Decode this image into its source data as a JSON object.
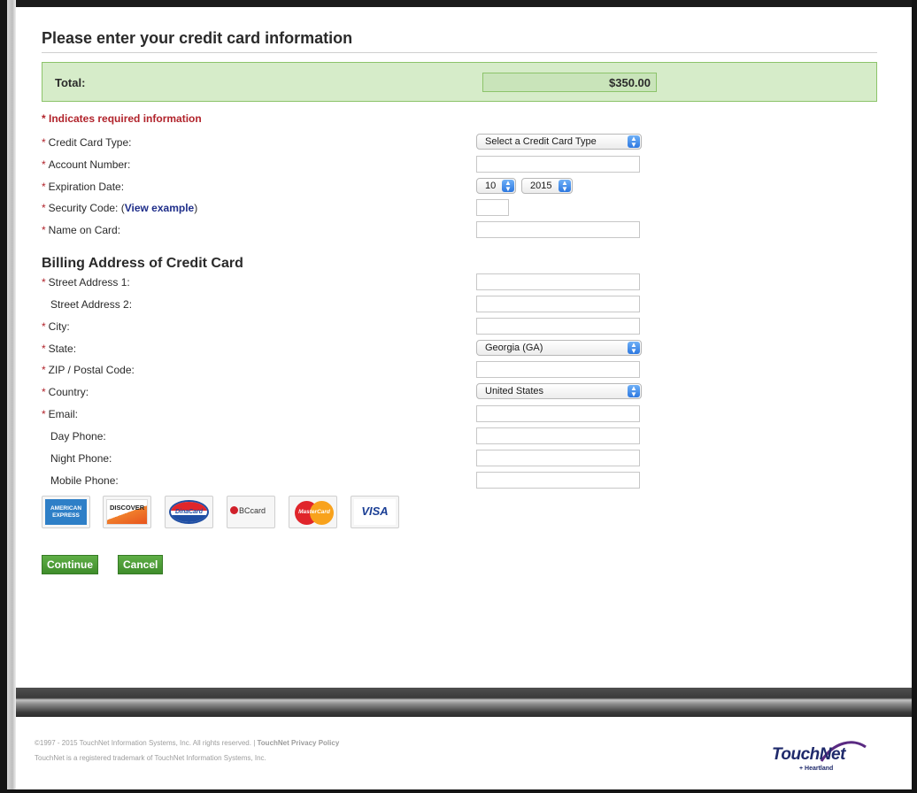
{
  "page": {
    "title": "Please enter your credit card information",
    "total_label": "Total:",
    "total_value": "$350.00",
    "required_note": "* Indicates required information",
    "billing_heading": "Billing Address of Credit Card"
  },
  "fields": {
    "card_type": {
      "label": "Credit Card Type:",
      "required": true,
      "value": "Select a Credit Card Type"
    },
    "account_number": {
      "label": "Account Number:",
      "required": true,
      "value": ""
    },
    "expiration": {
      "label": "Expiration Date:",
      "required": true,
      "month": "10",
      "year": "2015"
    },
    "security_code": {
      "label": "Security Code: (",
      "link": "View example",
      "after": ")",
      "required": true,
      "value": ""
    },
    "name_on_card": {
      "label": "Name on Card:",
      "required": true,
      "value": ""
    },
    "street1": {
      "label": "Street Address 1:",
      "required": true,
      "value": ""
    },
    "street2": {
      "label": "Street Address 2:",
      "required": false,
      "value": ""
    },
    "city": {
      "label": "City:",
      "required": true,
      "value": ""
    },
    "state": {
      "label": "State:",
      "required": true,
      "value": "Georgia (GA)"
    },
    "zip": {
      "label": "ZIP / Postal Code:",
      "required": true,
      "value": ""
    },
    "country": {
      "label": "Country:",
      "required": true,
      "value": "United States"
    },
    "email": {
      "label": "Email:",
      "required": true,
      "value": ""
    },
    "day_phone": {
      "label": "Day Phone:",
      "required": false,
      "value": ""
    },
    "night_phone": {
      "label": "Night Phone:",
      "required": false,
      "value": ""
    },
    "mobile_phone": {
      "label": "Mobile Phone:",
      "required": false,
      "value": ""
    }
  },
  "required_marker": "*",
  "select_arrow_up": "▲",
  "select_arrow_down": "▼",
  "cards": {
    "amex_line1": "AMERICAN",
    "amex_line2": "EXPRESS",
    "discover": "DISCOVER",
    "dinacard": "DinaCard",
    "bccard": "BCcard",
    "mastercard": "MasterCard",
    "visa": "VISA"
  },
  "buttons": {
    "continue": "Continue",
    "cancel": "Cancel"
  },
  "footer": {
    "copyright": "©1997 - 2015 TouchNet Information Systems, Inc. All rights reserved. | ",
    "privacy_link": "TouchNet Privacy Policy",
    "trademark": "TouchNet is a registered trademark of TouchNet Information Systems, Inc.",
    "logo_word": "TouchNet",
    "logo_sub": "+ Heartland"
  },
  "colors": {
    "accent_green": "#8cc46a",
    "required_red": "#b1232b",
    "button_green": "#4f9e38",
    "link_blue": "#1f2e8a"
  }
}
